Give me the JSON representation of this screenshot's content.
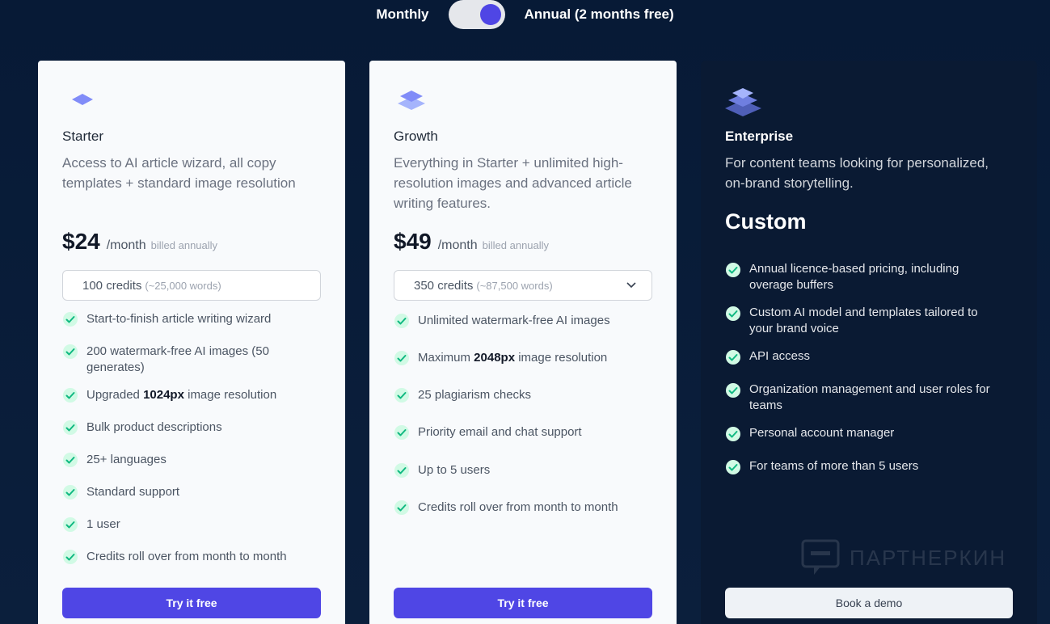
{
  "toggle": {
    "monthly_label": "Monthly",
    "annual_label": "Annual (2 months free)",
    "selected": "annual"
  },
  "plans": {
    "starter": {
      "name": "Starter",
      "description": "Access to AI article wizard, all copy templates + standard image resolution",
      "price": "$24",
      "period": "/month",
      "billing": "billed annually",
      "credits": "100 credits",
      "words": "(~25,000 words)",
      "features": [
        {
          "pre": "Start-to-finish article writing wizard",
          "bold": "",
          "post": ""
        },
        {
          "pre": "200 watermark-free AI images (50 generates)",
          "bold": "",
          "post": ""
        },
        {
          "pre": "Upgraded ",
          "bold": "1024px",
          "post": " image resolution"
        },
        {
          "pre": "Bulk product descriptions",
          "bold": "",
          "post": ""
        },
        {
          "pre": "25+ languages",
          "bold": "",
          "post": ""
        },
        {
          "pre": "Standard support",
          "bold": "",
          "post": ""
        },
        {
          "pre": "1 user",
          "bold": "",
          "post": ""
        },
        {
          "pre": "Credits roll over from month to month",
          "bold": "",
          "post": ""
        }
      ],
      "cta": "Try it free"
    },
    "growth": {
      "name": "Growth",
      "description": "Everything in Starter + unlimited high-resolution images and advanced article writing features.",
      "price": "$49",
      "period": "/month",
      "billing": "billed annually",
      "credits": "350 credits",
      "words": "(~87,500 words)",
      "features": [
        {
          "pre": "Unlimited watermark-free AI images",
          "bold": "",
          "post": ""
        },
        {
          "pre": "Maximum ",
          "bold": "2048px",
          "post": " image resolution"
        },
        {
          "pre": "25 plagiarism checks",
          "bold": "",
          "post": ""
        },
        {
          "pre": "Priority email and chat support",
          "bold": "",
          "post": ""
        },
        {
          "pre": "Up to 5 users",
          "bold": "",
          "post": ""
        },
        {
          "pre": "Credits roll over from month to month",
          "bold": "",
          "post": ""
        }
      ],
      "cta": "Try it free"
    },
    "enterprise": {
      "name": "Enterprise",
      "description": "For content teams looking for personalized, on-brand storytelling.",
      "price": "Custom",
      "features": [
        {
          "pre": "Annual licence-based pricing, including overage buffers",
          "bold": "",
          "post": ""
        },
        {
          "pre": "Custom AI model and templates tailored to your brand voice",
          "bold": "",
          "post": ""
        },
        {
          "pre": "API access",
          "bold": "",
          "post": ""
        },
        {
          "pre": "Organization management and user roles for teams",
          "bold": "",
          "post": ""
        },
        {
          "pre": "Personal account manager",
          "bold": "",
          "post": ""
        },
        {
          "pre": "For teams of more than 5 users",
          "bold": "",
          "post": ""
        }
      ],
      "cta": "Book a demo"
    }
  },
  "watermark": "ПАРТНЕРКИН",
  "colors": {
    "accent": "#4f46e5",
    "background": "#071a36",
    "enterprise_card": "#0a1a33",
    "check_bg": "#d1fae5",
    "check_mark": "#10b981"
  },
  "icons": [
    "layer-icon",
    "layers-stack-icon",
    "layers-stack-large-icon",
    "check-icon",
    "chevron-down-icon"
  ]
}
